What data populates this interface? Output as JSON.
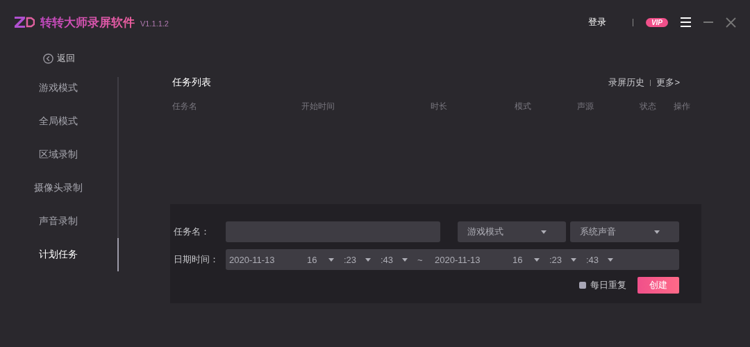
{
  "header": {
    "app_name": "转转大师录屏软件",
    "version": "V1.1.1.2",
    "login": "登录",
    "vip": "VIP"
  },
  "back": "返回",
  "sidebar": {
    "items": [
      {
        "label": "游戏模式",
        "selected": false
      },
      {
        "label": "全局模式",
        "selected": false
      },
      {
        "label": "区域录制",
        "selected": false
      },
      {
        "label": "摄像头录制",
        "selected": false
      },
      {
        "label": "声音录制",
        "selected": false
      },
      {
        "label": "计划任务",
        "selected": true
      }
    ]
  },
  "task_list": {
    "title": "任务列表",
    "links": [
      "录屏历史",
      "更多>"
    ],
    "columns": [
      "任务名",
      "开始时间",
      "时长",
      "模式",
      "声源",
      "状态",
      "操作"
    ]
  },
  "form": {
    "name_label": "任务名：",
    "mode": "游戏模式",
    "audio": "系统声音",
    "datetime_label": "日期时间：",
    "start": {
      "date": "2020-11-13",
      "hour": "16",
      "minute": ":23",
      "second": ":43"
    },
    "separator": "~",
    "end": {
      "date": "2020-11-13",
      "hour": "16",
      "minute": ":23",
      "second": ":43"
    },
    "daily_repeat": {
      "label": "每日重复",
      "checked": false
    },
    "create": "创建"
  }
}
